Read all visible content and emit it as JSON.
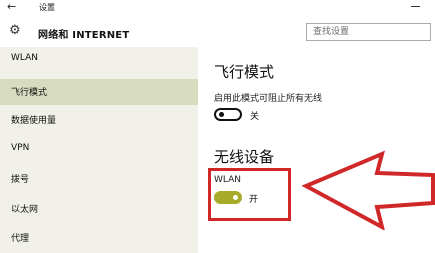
{
  "window": {
    "title": "设置"
  },
  "header": {
    "title": "网络和 INTERNET"
  },
  "search": {
    "placeholder": "查找设置"
  },
  "sidebar": {
    "items": [
      {
        "label": "WLAN"
      },
      {
        "label": "飞行模式",
        "active": true
      },
      {
        "label": "数据使用量"
      },
      {
        "label": "VPN"
      },
      {
        "label": "拨号"
      },
      {
        "label": "以太网"
      },
      {
        "label": "代理"
      }
    ]
  },
  "main": {
    "airplane": {
      "title": "飞行模式",
      "description": "启用此模式可阻止所有无线",
      "toggle_state": "关"
    },
    "wireless": {
      "title": "无线设备",
      "wlan_label": "WLAN",
      "toggle_state": "开"
    }
  },
  "colors": {
    "sidebar_bg": "#f1f1ea",
    "sidebar_active": "#d8dcbf",
    "toggle_on": "#a8ab2a",
    "annotation_red": "#d02828"
  },
  "icons": {
    "back": "back-arrow-icon",
    "header": "gear-icon",
    "minimize": "minimize-icon",
    "annotation": "arrow-left-icon"
  }
}
